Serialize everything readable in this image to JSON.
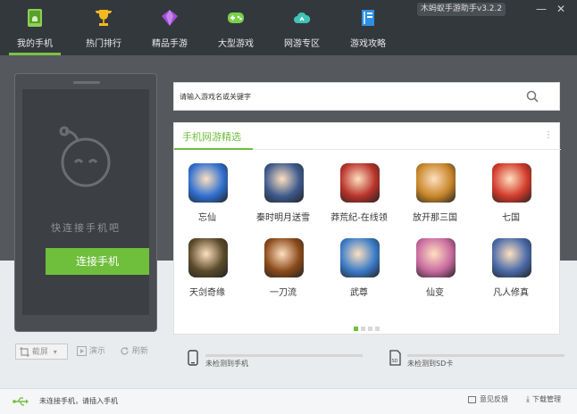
{
  "window": {
    "version": "木蚂蚁手游助手v3.2.2",
    "minimize": "—",
    "close": "✕"
  },
  "nav": [
    {
      "label": "我的手机",
      "icon": "android-phone-icon"
    },
    {
      "label": "热门排行",
      "icon": "trophy-icon"
    },
    {
      "label": "精品手游",
      "icon": "gem-icon"
    },
    {
      "label": "大型游戏",
      "icon": "gamepad-icon"
    },
    {
      "label": "网游专区",
      "icon": "cloud-icon"
    },
    {
      "label": "游戏攻略",
      "icon": "book-icon"
    }
  ],
  "phone": {
    "hint": "快连接手机吧",
    "connect_label": "连接手机"
  },
  "tools": {
    "screenshot": "截屏",
    "demo": "演示",
    "refresh": "刷新"
  },
  "search": {
    "placeholder": "请输入游戏名或关键字"
  },
  "panel": {
    "title": "手机网游精选",
    "more": "⋮"
  },
  "games": [
    {
      "name": "忘仙",
      "color": "#2f6fd0"
    },
    {
      "name": "秦时明月送雪",
      "color": "#3d5a8c"
    },
    {
      "name": "莽荒纪-在线领",
      "color": "#b8322b"
    },
    {
      "name": "放开那三国",
      "color": "#c8862a"
    },
    {
      "name": "七国",
      "color": "#d23b2b"
    },
    {
      "name": "天剑奇缘",
      "color": "#5a4a2a"
    },
    {
      "name": "一刀流",
      "color": "#8a4a1a"
    },
    {
      "name": "武尊",
      "color": "#3a7bc8"
    },
    {
      "name": "仙变",
      "color": "#c86aa0"
    },
    {
      "name": "凡人修真",
      "color": "#4a6aa8"
    }
  ],
  "status": {
    "phone": "未检测到手机",
    "sd": "未检测到SD卡",
    "sd_icon_text": "SD"
  },
  "footer": {
    "connection": "未连接手机，请插入手机",
    "feedback": "意见反馈",
    "downloads": "下载管理"
  },
  "colors": {
    "accent": "#6fbe3c",
    "header": "#33383d"
  }
}
